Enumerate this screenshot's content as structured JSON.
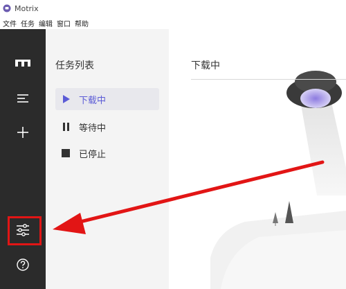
{
  "window": {
    "title": "Motrix"
  },
  "menubar": {
    "items": [
      "文件",
      "任务",
      "编辑",
      "窗口",
      "帮助"
    ]
  },
  "tasks": {
    "title": "任务列表",
    "items": [
      {
        "label": "下载中",
        "icon": "play-icon",
        "active": true
      },
      {
        "label": "等待中",
        "icon": "pause-icon",
        "active": false
      },
      {
        "label": "已停止",
        "icon": "stop-icon",
        "active": false
      }
    ]
  },
  "main": {
    "title": "下载中"
  },
  "colors": {
    "accent": "#5b5bd6",
    "rail": "#2b2b2b",
    "annotation": "#e21515"
  }
}
